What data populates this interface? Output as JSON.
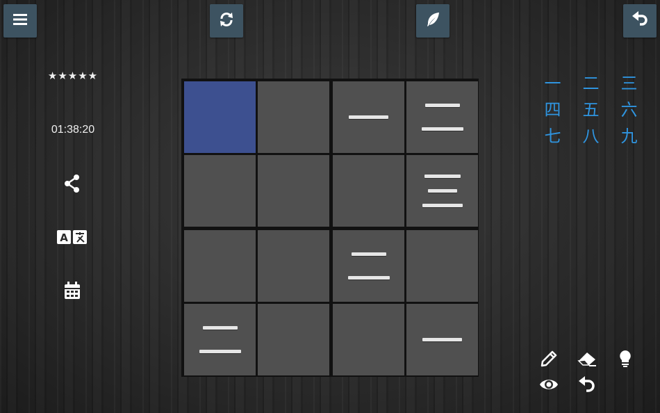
{
  "toolbar": {
    "menu_icon": "menu-icon",
    "refresh_icon": "refresh-icon",
    "feather_icon": "feather-icon",
    "undo_icon": "undo-icon"
  },
  "side": {
    "rating": "★★★★★",
    "timer": "01:38:20",
    "icons": [
      "share-icon",
      "translate-icon",
      "calendar-icon"
    ]
  },
  "board": {
    "size": 4,
    "selected": [
      0,
      0
    ],
    "cells": [
      [
        0,
        0,
        1,
        2
      ],
      [
        0,
        0,
        0,
        3
      ],
      [
        0,
        0,
        2,
        0
      ],
      [
        2,
        0,
        0,
        1
      ]
    ]
  },
  "palette": [
    "一",
    "二",
    "三",
    "四",
    "五",
    "六",
    "七",
    "八",
    "九"
  ],
  "tools": [
    "pencil-icon",
    "eraser-icon",
    "hint-icon",
    "eye-icon",
    "undo-icon"
  ],
  "colors": {
    "button_bg": "#3d5361",
    "selected_cell": "#3d5090",
    "cell": "#505050",
    "numeral": "#2f94df"
  }
}
